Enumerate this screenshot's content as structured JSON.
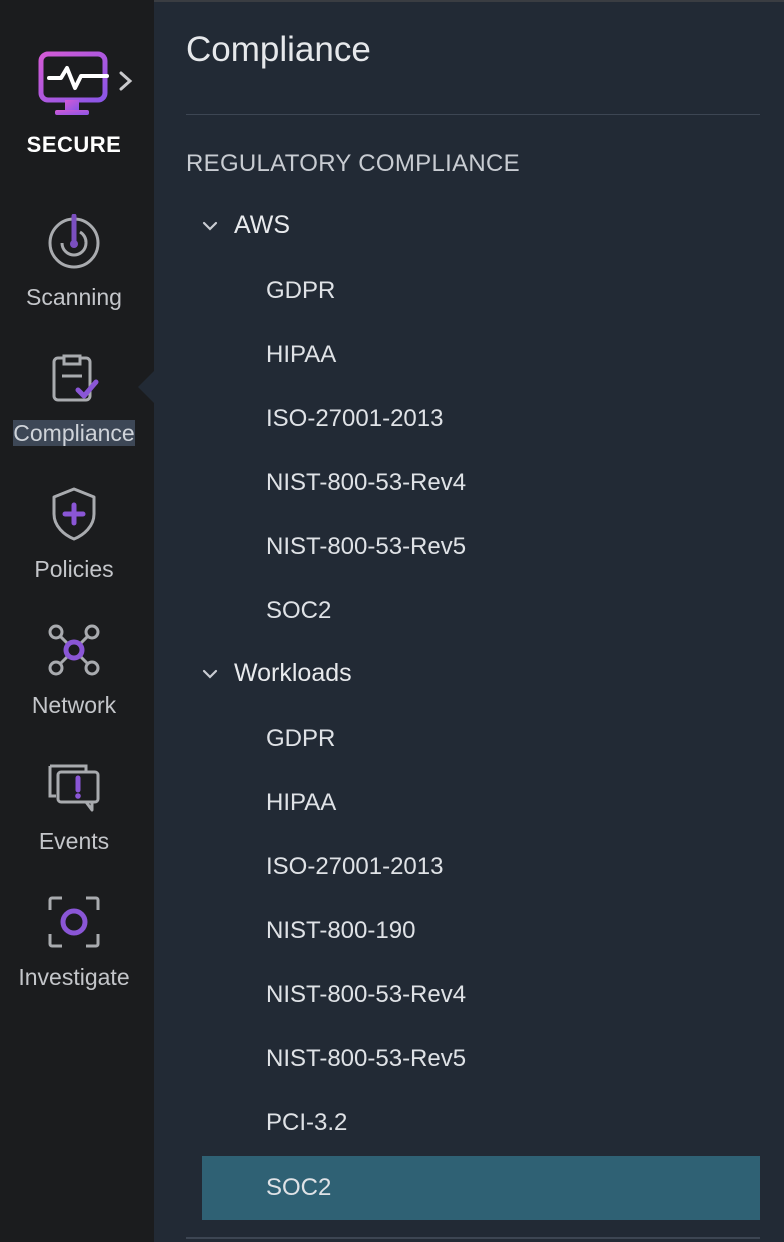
{
  "brand": {
    "name": "SECURE",
    "icon": "monitor-pulse-icon",
    "accent": "#a35fe0"
  },
  "sidebar": {
    "items": [
      {
        "label": "Scanning",
        "icon": "scan-gauge-icon",
        "active": false
      },
      {
        "label": "Compliance",
        "icon": "clipboard-check-icon",
        "active": true
      },
      {
        "label": "Policies",
        "icon": "shield-plus-icon",
        "active": false
      },
      {
        "label": "Network",
        "icon": "network-nodes-icon",
        "active": false
      },
      {
        "label": "Events",
        "icon": "chat-alert-icon",
        "active": false
      },
      {
        "label": "Investigate",
        "icon": "focus-circle-icon",
        "active": false
      }
    ]
  },
  "main": {
    "title": "Compliance",
    "section": "REGULATORY COMPLIANCE",
    "groups": [
      {
        "label": "AWS",
        "expanded": true,
        "items": [
          "GDPR",
          "HIPAA",
          "ISO-27001-2013",
          "NIST-800-53-Rev4",
          "NIST-800-53-Rev5",
          "SOC2"
        ]
      },
      {
        "label": "Workloads",
        "expanded": true,
        "items": [
          "GDPR",
          "HIPAA",
          "ISO-27001-2013",
          "NIST-800-190",
          "NIST-800-53-Rev4",
          "NIST-800-53-Rev5",
          "PCI-3.2",
          "SOC2"
        ]
      }
    ],
    "selected": "Workloads / SOC2"
  },
  "colors": {
    "sidebar_bg": "#1b1c1e",
    "panel_bg": "#222a35",
    "selected_bg": "#2f6174",
    "accent_purple": "#7b4fc0"
  }
}
